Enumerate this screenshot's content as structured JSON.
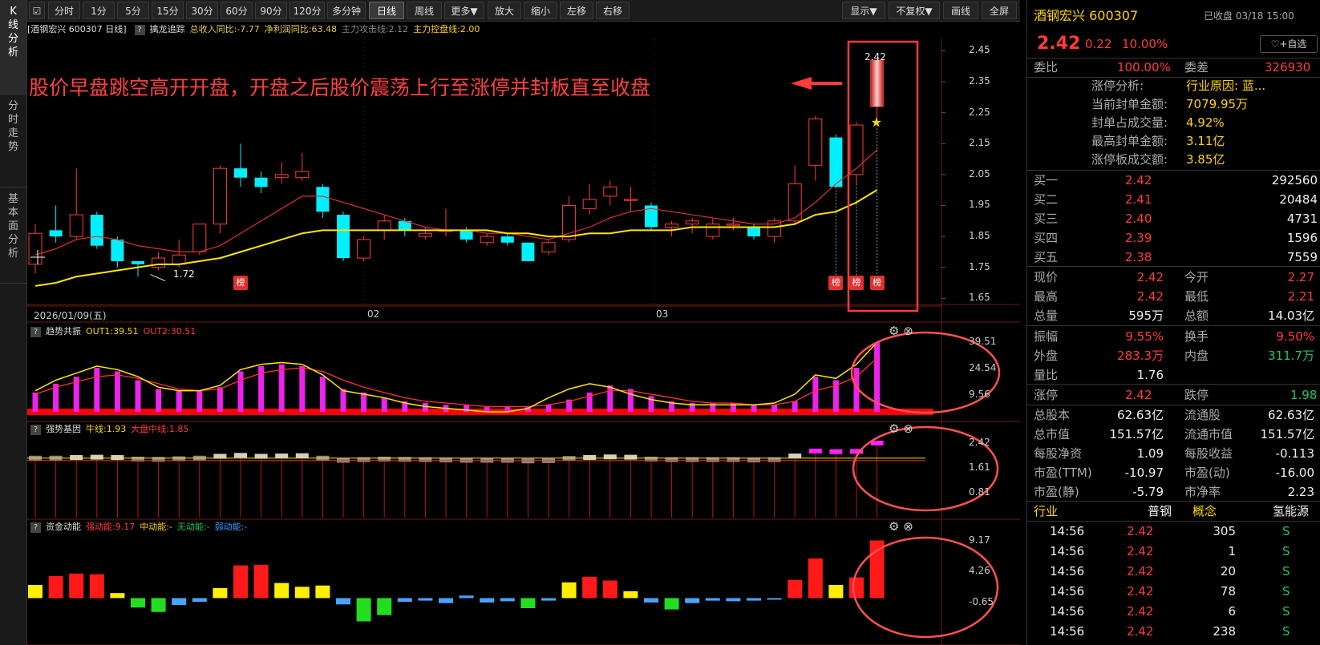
{
  "side_tabs": [
    {
      "label": "K\n线\n分\n析"
    },
    {
      "label": "分\n时\n走\n势"
    },
    {
      "label": "基\n本\n面\n分\n析"
    }
  ],
  "toolbar": {
    "periods": [
      "分时",
      "1分",
      "5分",
      "15分",
      "30分",
      "60分",
      "90分",
      "120分",
      "多分钟",
      "日线",
      "周线",
      "更多▼"
    ],
    "active_period": "日线",
    "tools": [
      "放大",
      "缩小",
      "左移",
      "右移"
    ],
    "right": [
      "显示▼",
      "不复权▼",
      "画线",
      "全屏"
    ]
  },
  "main_pane": {
    "header": {
      "title": "[酒钢宏兴 600307 日线]",
      "indicator": "擒龙追踪",
      "values": [
        {
          "text": "总收入同比:-7.77",
          "color": "#e6c84c"
        },
        {
          "text": "净利润同比:63.48",
          "color": "#e6c84c"
        },
        {
          "text": "主力攻击线:2.12",
          "color": "#888888"
        },
        {
          "text": "主力控盘线:2.00",
          "color": "#ffd400"
        }
      ]
    },
    "y_ticks": [
      "2.45",
      "2.35",
      "2.25",
      "2.15",
      "2.05",
      "1.95",
      "1.85",
      "1.75",
      "1.65"
    ],
    "x_labels": [
      "2026/01/09(五)",
      "02",
      "03"
    ],
    "low_label": "1.72",
    "high_label": "2.42",
    "badge": "榜"
  },
  "annotation": "股价早盘跳空高开开盘，开盘之后股价震荡上行至涨停并封板直至收盘",
  "panes": [
    {
      "name": "趋势共振",
      "values": [
        {
          "text": "OUT1:39.51",
          "color": "#ffd400"
        },
        {
          "text": "OUT2:30.51",
          "color": "#ff3b3b"
        }
      ],
      "y_ticks": [
        "39.51",
        "24.54",
        "9.56"
      ]
    },
    {
      "name": "强势基因",
      "values": [
        {
          "text": "牛线:1.93",
          "color": "#ffd400"
        },
        {
          "text": "大盘中线:1.85",
          "color": "#ff3b3b"
        }
      ],
      "y_ticks": [
        "2.42",
        "1.61",
        "0.81"
      ]
    },
    {
      "name": "资金动能",
      "values": [
        {
          "text": "强动能:9.17",
          "color": "#ff3b3b"
        },
        {
          "text": "中动能:-",
          "color": "#ffd400"
        },
        {
          "text": "无动能:-",
          "color": "#22c55e"
        },
        {
          "text": "弱动能:-",
          "color": "#3b9dff"
        }
      ],
      "y_ticks": [
        "9.17",
        "4.26",
        "-0.65"
      ]
    }
  ],
  "chart_data": [
    {
      "type": "candlestick",
      "title": "酒钢宏兴 600307 日线",
      "ylim": [
        1.63,
        2.49
      ],
      "candles": [
        [
          1.76,
          1.86,
          1.89,
          1.73
        ],
        [
          1.87,
          1.85,
          1.95,
          1.83
        ],
        [
          1.85,
          1.92,
          2.07,
          1.84
        ],
        [
          1.92,
          1.82,
          1.93,
          1.81
        ],
        [
          1.84,
          1.77,
          1.85,
          1.75
        ],
        [
          1.77,
          1.76,
          1.77,
          1.72
        ],
        [
          1.75,
          1.78,
          1.8,
          1.74
        ],
        [
          1.76,
          1.79,
          1.84,
          1.75
        ],
        [
          1.8,
          1.89,
          1.89,
          1.79
        ],
        [
          1.89,
          2.07,
          2.08,
          1.86
        ],
        [
          2.07,
          2.04,
          2.15,
          2.01
        ],
        [
          2.04,
          2.01,
          2.06,
          1.99
        ],
        [
          2.04,
          2.05,
          2.09,
          2.02
        ],
        [
          2.04,
          2.06,
          2.12,
          2.03
        ],
        [
          2.01,
          1.93,
          2.02,
          1.91
        ],
        [
          1.92,
          1.78,
          1.93,
          1.77
        ],
        [
          1.78,
          1.84,
          1.85,
          1.77
        ],
        [
          1.87,
          1.9,
          1.92,
          1.84
        ],
        [
          1.9,
          1.87,
          1.91,
          1.85
        ],
        [
          1.85,
          1.86,
          1.88,
          1.84
        ],
        [
          1.87,
          1.87,
          1.94,
          1.85
        ],
        [
          1.87,
          1.84,
          1.88,
          1.83
        ],
        [
          1.83,
          1.85,
          1.86,
          1.82
        ],
        [
          1.85,
          1.83,
          1.86,
          1.82
        ],
        [
          1.83,
          1.77,
          1.83,
          1.77
        ],
        [
          1.8,
          1.83,
          1.84,
          1.79
        ],
        [
          1.84,
          1.95,
          1.98,
          1.83
        ],
        [
          1.94,
          1.97,
          2.02,
          1.92
        ],
        [
          1.98,
          2.01,
          2.03,
          1.95
        ],
        [
          1.97,
          1.97,
          2.01,
          1.93
        ],
        [
          1.95,
          1.88,
          1.96,
          1.87
        ],
        [
          1.88,
          1.89,
          1.9,
          1.85
        ],
        [
          1.89,
          1.9,
          1.91,
          1.86
        ],
        [
          1.85,
          1.89,
          1.91,
          1.84
        ],
        [
          1.89,
          1.89,
          1.91,
          1.87
        ],
        [
          1.88,
          1.85,
          1.89,
          1.84
        ],
        [
          1.85,
          1.9,
          1.91,
          1.83
        ],
        [
          1.9,
          2.02,
          2.08,
          1.89
        ],
        [
          2.08,
          2.23,
          2.24,
          2.03
        ],
        [
          2.17,
          2.01,
          2.18,
          2.01
        ],
        [
          2.05,
          2.21,
          2.22,
          2.02
        ],
        [
          2.27,
          2.42,
          2.42,
          2.21
        ]
      ],
      "ma_fast": [
        1.79,
        1.81,
        1.84,
        1.85,
        1.84,
        1.82,
        1.81,
        1.8,
        1.8,
        1.82,
        1.86,
        1.9,
        1.94,
        1.98,
        1.98,
        1.96,
        1.94,
        1.92,
        1.9,
        1.88,
        1.87,
        1.87,
        1.86,
        1.86,
        1.85,
        1.84,
        1.86,
        1.88,
        1.91,
        1.93,
        1.94,
        1.93,
        1.92,
        1.91,
        1.9,
        1.89,
        1.89,
        1.91,
        1.96,
        2.02,
        2.07,
        2.13
      ],
      "ma_slow": [
        1.69,
        1.7,
        1.72,
        1.73,
        1.74,
        1.75,
        1.76,
        1.76,
        1.77,
        1.78,
        1.8,
        1.82,
        1.84,
        1.86,
        1.87,
        1.87,
        1.87,
        1.87,
        1.87,
        1.87,
        1.87,
        1.87,
        1.87,
        1.86,
        1.86,
        1.85,
        1.85,
        1.86,
        1.86,
        1.87,
        1.87,
        1.87,
        1.88,
        1.88,
        1.88,
        1.88,
        1.88,
        1.89,
        1.92,
        1.93,
        1.96,
        2.0
      ],
      "badge_indices": [
        10,
        39,
        40,
        41
      ]
    },
    {
      "type": "bar",
      "title": "趋势共振",
      "ylim": [
        0,
        41
      ],
      "values": [
        11,
        16,
        20,
        25,
        23,
        18,
        13,
        12,
        12,
        14,
        23,
        26,
        27,
        26,
        20,
        13,
        11,
        8,
        6,
        5,
        4,
        4,
        3,
        3,
        3,
        4,
        7,
        11,
        15,
        13,
        9,
        6,
        5,
        5,
        5,
        4,
        4,
        6,
        20,
        18,
        25,
        39.51
      ],
      "out1": [
        12,
        18,
        22,
        26,
        24,
        20,
        14,
        12,
        12,
        15,
        24,
        27,
        28,
        27,
        21,
        12,
        10,
        8,
        5,
        3,
        2,
        1,
        0,
        0,
        2,
        8,
        13,
        16,
        14,
        10,
        7,
        5,
        4,
        4,
        4,
        4,
        5,
        10,
        21,
        19,
        27,
        39.51
      ],
      "out2": [
        10,
        14,
        17,
        20,
        21,
        19,
        16,
        13,
        12,
        13,
        18,
        22,
        24,
        25,
        23,
        18,
        14,
        11,
        8,
        6,
        5,
        4,
        3,
        3,
        3,
        4,
        6,
        9,
        12,
        12,
        10,
        8,
        6,
        5,
        5,
        4,
        4,
        6,
        12,
        15,
        20,
        30.51
      ]
    },
    {
      "type": "bar",
      "title": "强势基因",
      "ylim": [
        0,
        2.6
      ],
      "values": [
        1.93,
        1.93,
        1.95,
        1.96,
        1.95,
        1.9,
        1.89,
        1.91,
        1.93,
        1.99,
        2.02,
        1.99,
        2.0,
        2.01,
        1.93,
        1.86,
        1.88,
        1.9,
        1.89,
        1.88,
        1.87,
        1.86,
        1.86,
        1.86,
        1.84,
        1.85,
        1.92,
        1.95,
        1.97,
        1.96,
        1.9,
        1.88,
        1.88,
        1.88,
        1.88,
        1.87,
        1.88,
        2.0,
        2.16,
        2.14,
        2.15,
        2.42
      ],
      "bull_line": 1.93,
      "market_line": 1.85
    },
    {
      "type": "bar",
      "title": "资金动能",
      "ylim": [
        -3.0,
        10.0
      ],
      "values": [
        2.1,
        3.5,
        3.9,
        3.8,
        0.8,
        -1.5,
        -2.2,
        -1.1,
        -0.6,
        1.6,
        5.2,
        5.3,
        2.4,
        1.8,
        2.0,
        -1.0,
        -3.7,
        -2.7,
        -0.6,
        -0.4,
        -0.8,
        0.4,
        -0.7,
        -0.5,
        -1.6,
        -0.4,
        2.5,
        3.4,
        2.8,
        1.1,
        -0.7,
        -1.8,
        -0.8,
        -0.4,
        -0.5,
        -0.4,
        0.0,
        2.9,
        6.3,
        2.1,
        3.3,
        9.17
      ]
    }
  ],
  "right_panel": {
    "stock_name": "酒钢宏兴 600307",
    "status": "已收盘 03/18 15:00",
    "price": "2.42",
    "change": "0.22",
    "change_pct": "10.00%",
    "follow_button": "+自选",
    "weibi_label": "委比",
    "weibi_value": "100.00%",
    "weicha_label": "委差",
    "weicha_value": "326930",
    "limit_info": [
      {
        "label": "涨停分析:",
        "value": "行业原因: 蓝..."
      },
      {
        "label": "当前封单金额:",
        "value": "7079.95万"
      },
      {
        "label": "封单占成交量:",
        "value": "4.92%"
      },
      {
        "label": "最高封单金额:",
        "value": "3.11亿"
      },
      {
        "label": "涨停板成交额:",
        "value": "3.85亿"
      }
    ],
    "bids": [
      {
        "label": "买一",
        "price": "2.42",
        "vol": "292560"
      },
      {
        "label": "买二",
        "price": "2.41",
        "vol": "20484"
      },
      {
        "label": "买三",
        "price": "2.40",
        "vol": "4731"
      },
      {
        "label": "买四",
        "price": "2.39",
        "vol": "1596"
      },
      {
        "label": "买五",
        "price": "2.38",
        "vol": "7559"
      }
    ],
    "quote1": [
      [
        "现价",
        "2.42",
        "今开",
        "2.27"
      ],
      [
        "最高",
        "2.42",
        "最低",
        "2.21"
      ],
      [
        "总量",
        "595万",
        "总额",
        "14.03亿"
      ]
    ],
    "quote2": [
      [
        "振幅",
        "9.55%",
        "换手",
        "9.50%"
      ],
      [
        "外盘",
        "283.3万",
        "内盘",
        "311.7万"
      ],
      [
        "量比",
        "1.76",
        "",
        ""
      ]
    ],
    "limit_row": [
      "涨停",
      "2.42",
      "跌停",
      "1.98"
    ],
    "fundamentals": [
      [
        "总股本",
        "62.63亿",
        "流通股",
        "62.63亿"
      ],
      [
        "总市值",
        "151.57亿",
        "流通市值",
        "151.57亿"
      ],
      [
        "每股净资",
        "1.09",
        "每股收益",
        "-0.113"
      ],
      [
        "市盈(TTM)",
        "-10.97",
        "市盈(动)",
        "-16.00"
      ],
      [
        "市盈(静)",
        "-5.79",
        "市净率",
        "2.23"
      ]
    ],
    "industry_row": [
      "行业",
      "普钢",
      "概念",
      "氢能源"
    ],
    "ticks": [
      [
        "14:56",
        "2.42",
        "305",
        "S"
      ],
      [
        "14:56",
        "2.42",
        "1",
        "S"
      ],
      [
        "14:56",
        "2.42",
        "20",
        "S"
      ],
      [
        "14:56",
        "2.42",
        "78",
        "S"
      ],
      [
        "14:56",
        "2.42",
        "6",
        "S"
      ],
      [
        "14:56",
        "2.42",
        "238",
        "S"
      ]
    ]
  }
}
